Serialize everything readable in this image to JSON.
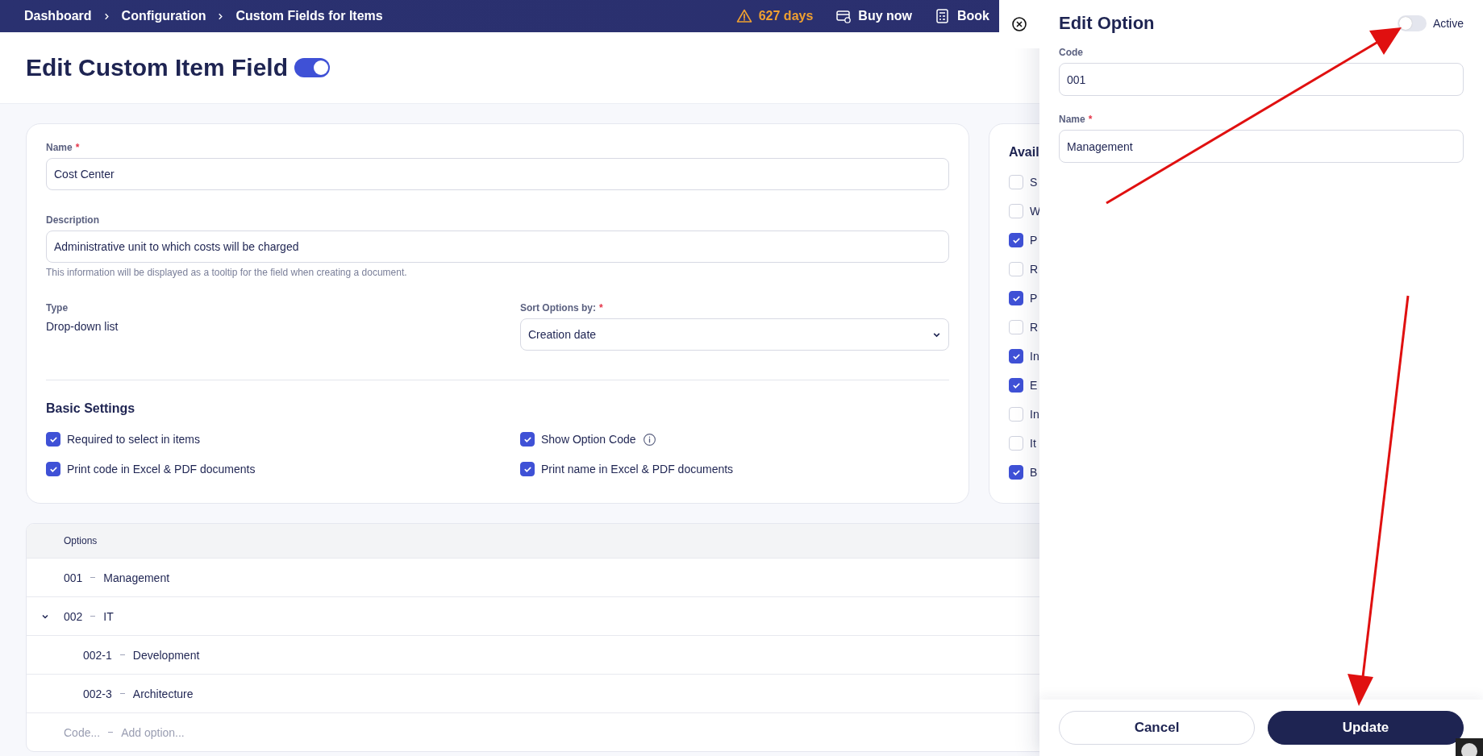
{
  "breadcrumbs": [
    {
      "label": "Dashboard"
    },
    {
      "label": "Configuration"
    },
    {
      "label": "Custom Fields for Items"
    }
  ],
  "top_actions": [
    {
      "kind": "warning",
      "label": "627 days"
    },
    {
      "kind": "buy",
      "label": "Buy now"
    },
    {
      "kind": "book",
      "label": "Book"
    }
  ],
  "page": {
    "title": "Edit Custom Item Field",
    "enabled": true
  },
  "form": {
    "name": {
      "label": "Name",
      "required_mark": "*",
      "value": "Cost Center"
    },
    "description": {
      "label": "Description",
      "value": "Administrative unit to which costs will be charged",
      "hint": "This information will be displayed as a tooltip for the field when creating a document."
    },
    "type": {
      "label": "Type",
      "value": "Drop-down list"
    },
    "sort": {
      "label": "Sort Options by:",
      "required_mark": "*",
      "value": "Creation date"
    },
    "basic_settings": {
      "title": "Basic Settings",
      "items": [
        {
          "label": "Required to select in items",
          "checked": true,
          "info": false
        },
        {
          "label": "Show Option Code",
          "checked": true,
          "info": true
        },
        {
          "label": "Print code in Excel & PDF documents",
          "checked": true,
          "info": false
        },
        {
          "label": "Print name in Excel & PDF documents",
          "checked": true,
          "info": false
        }
      ]
    }
  },
  "available": {
    "title": "Avail",
    "items": [
      {
        "label": "S",
        "checked": false
      },
      {
        "label": "W",
        "checked": false
      },
      {
        "label": "P",
        "checked": true
      },
      {
        "label": "R",
        "checked": false
      },
      {
        "label": "P",
        "checked": true
      },
      {
        "label": "R",
        "checked": false
      },
      {
        "label": "In",
        "checked": true
      },
      {
        "label": "E",
        "checked": true
      },
      {
        "label": "In",
        "checked": false
      },
      {
        "label": "It",
        "checked": false
      },
      {
        "label": "B",
        "checked": true
      }
    ]
  },
  "options": {
    "header": "Options",
    "rows": [
      {
        "code": "001",
        "name": "Management"
      },
      {
        "code": "002",
        "name": "IT",
        "expanded": true,
        "children": [
          {
            "code": "002-1",
            "name": "Development"
          },
          {
            "code": "002-3",
            "name": "Architecture"
          }
        ]
      }
    ],
    "add_row": {
      "code_placeholder": "Code...",
      "name_placeholder": "Add option..."
    }
  },
  "panel": {
    "title": "Edit Option",
    "active": {
      "label": "Active",
      "on": false
    },
    "code": {
      "label": "Code",
      "value": "001"
    },
    "name": {
      "label": "Name",
      "required_mark": "*",
      "value": "Management"
    },
    "buttons": [
      {
        "kind": "secondary",
        "label": "Cancel"
      },
      {
        "kind": "primary",
        "label": "Update"
      }
    ]
  }
}
